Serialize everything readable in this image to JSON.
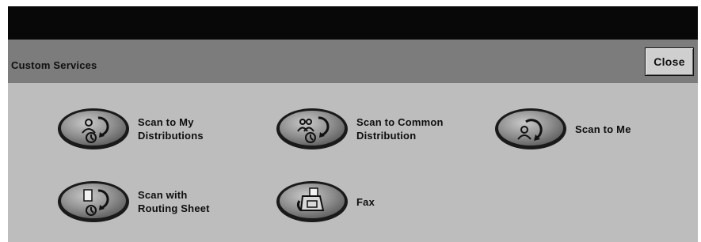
{
  "window": {
    "title": "Custom Services",
    "close_label": "Close"
  },
  "services": [
    {
      "label": "Scan to My\nDistributions",
      "icon": "scan-to-my-distributions-icon"
    },
    {
      "label": "Scan to Common\nDistribution",
      "icon": "scan-to-common-distribution-icon"
    },
    {
      "label": "Scan to Me",
      "icon": "scan-to-me-icon"
    },
    {
      "label": "Scan with\nRouting Sheet",
      "icon": "scan-with-routing-sheet-icon"
    },
    {
      "label": "Fax",
      "icon": "fax-icon"
    }
  ]
}
